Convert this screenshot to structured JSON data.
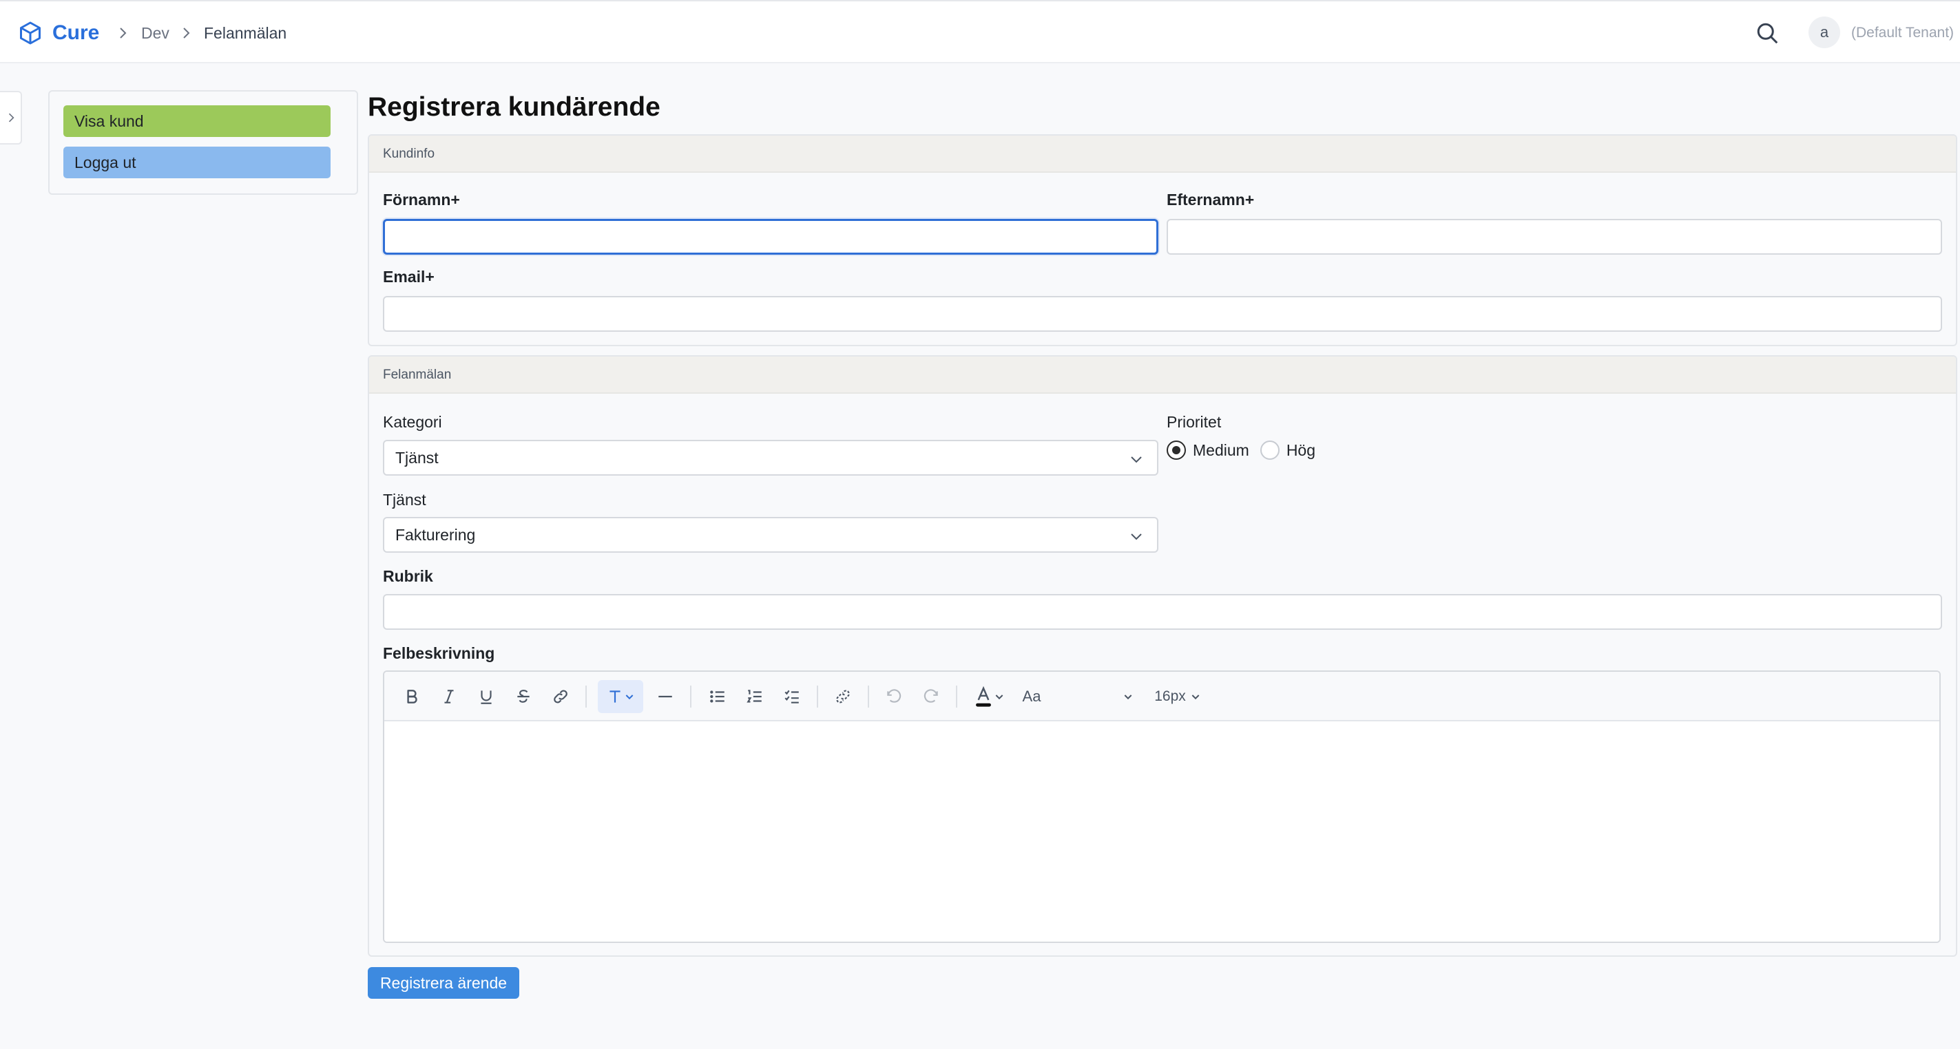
{
  "header": {
    "brand": "Cure",
    "breadcrumb": [
      "Dev",
      "Felanmälan"
    ],
    "avatar_initial": "a",
    "tenant": "(Default Tenant)"
  },
  "sidebar": {
    "buttons": [
      {
        "label": "Visa kund",
        "color": "#9cc95a"
      },
      {
        "label": "Logga ut",
        "color": "#8ab9ee"
      }
    ]
  },
  "page": {
    "title": "Registrera kundärende"
  },
  "kundinfo": {
    "heading": "Kundinfo",
    "firstname_label": "Förnamn+",
    "firstname_value": "",
    "lastname_label": "Efternamn+",
    "lastname_value": "",
    "email_label": "Email+",
    "email_value": ""
  },
  "felanmalan": {
    "heading": "Felanmälan",
    "category_label": "Kategori",
    "category_value": "Tjänst",
    "priority_label": "Prioritet",
    "priority_options": [
      {
        "label": "Medium",
        "selected": true
      },
      {
        "label": "Hög",
        "selected": false
      }
    ],
    "service_label": "Tjänst",
    "service_value": "Fakturering",
    "subject_label": "Rubrik",
    "subject_value": "",
    "description_label": "Felbeskrivning",
    "editor": {
      "font_size": "16px",
      "text_color": "#111111",
      "tools": [
        "bold-icon",
        "italic-icon",
        "underline-icon",
        "strikethrough-icon",
        "link-icon",
        "text-style-icon",
        "horizontal-rule-icon",
        "bullet-list-icon",
        "ordered-list-icon",
        "task-list-icon",
        "unlink-icon",
        "undo-icon",
        "redo-icon",
        "text-color-icon",
        "font-family-icon"
      ]
    }
  },
  "actions": {
    "submit_label": "Registrera ärende"
  },
  "colors": {
    "accent": "#2a6fdb",
    "submit": "#3d8ae0",
    "focus": "#2f6fd6"
  }
}
